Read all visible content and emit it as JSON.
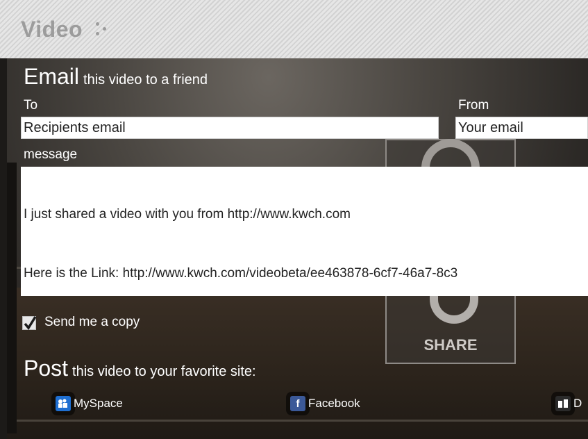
{
  "header": {
    "title": "Video"
  },
  "email": {
    "heading_big": "Email",
    "heading_small": "this video to a friend",
    "to_label": "To",
    "from_label": "From",
    "to_value": "Recipients email",
    "from_value": "Your email",
    "message_label": "message",
    "message_line1": "I just shared a video with you from http://www.kwch.com",
    "message_line2": "Here is the Link: http://www.kwch.com/videobeta/ee463878-6cf7-46a7-8c3",
    "send_copy_label": "Send me a copy",
    "send_copy_checked": true
  },
  "share_overlay": {
    "label": "SHARE"
  },
  "post": {
    "heading_big": "Post",
    "heading_small": "this video to your favorite site:",
    "sites": [
      {
        "name": "MySpace",
        "icon": "myspace-icon",
        "color": "#1f6fd1"
      },
      {
        "name": "Facebook",
        "icon": "facebook-icon",
        "color": "#3b5998"
      },
      {
        "name": "D",
        "icon": "digg-icon",
        "color": "#2a2a2a"
      }
    ]
  }
}
